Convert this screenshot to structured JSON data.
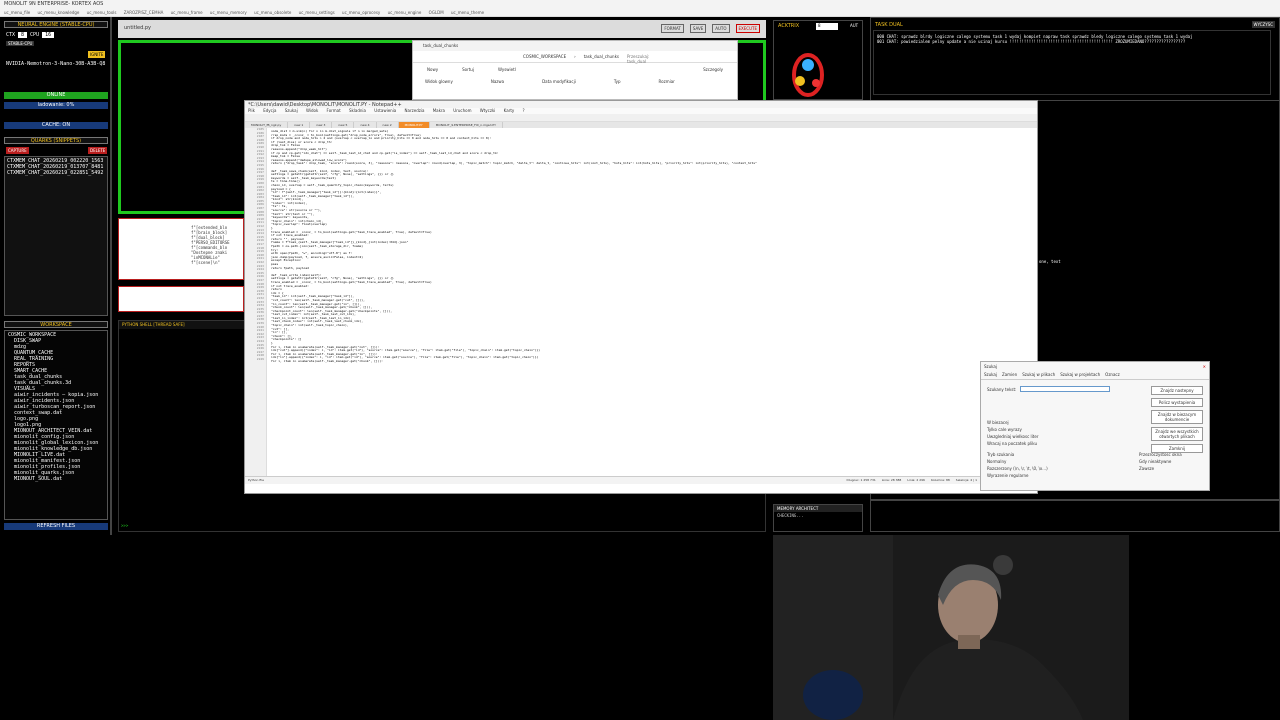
{
  "outer_window": {
    "title": "MONOLIT 9N ENTERPRISE- KORTEX AOS",
    "menu": [
      "uc_menu_file",
      "uc_menu_knowledge",
      "uc_menu_tools",
      "ZAROZPISZ_CEMHA",
      "uc_menu_frame",
      "uc_menu_memory",
      "uc_menu_obsolete",
      "uc_menu_settings",
      "uc_menu_oprocesy",
      "uc_menu_engine",
      "OGLDM",
      "uc_menu_theme"
    ]
  },
  "neural_engine": {
    "title": "NEURAL ENGINE (STABLE-CPU)",
    "ctx_label": "CTX",
    "ctx_value": "8",
    "cpu_label": "CPU",
    "cpu_value": "16",
    "badge": "STABLE-CPU",
    "ignite_button": "IGNITE",
    "model_name": "NVIDIA-Nemotron-3-Nano-30B-A3B-Q8",
    "online_label": "ONLINE",
    "loading_label": "ladowanie: 0%",
    "cache_label": "CACHE: ON"
  },
  "quarks": {
    "title": "QUARKS (SNIPPETS)",
    "capture_button": "CAPTURE",
    "delete_button": "DELETE",
    "items": [
      "CTXMEM_CHAT_20260219_002220_1563",
      "CTXMEM_CHAT_20260219_013707_8481",
      "CTXMEM_CHAT_20260219_022851_5492"
    ]
  },
  "workspace": {
    "title": "WORKSPACE",
    "root": "COSMIC_WORKSPACE",
    "items": [
      "DISK_SWAP",
      "mdzg",
      "QUANTUM_CACHE",
      "REAL_TRAINING",
      "REPORTS",
      "SMART_CACHE",
      "task_dual_chunks",
      "task_dual_chunks.3d",
      "VISUALS",
      "aiwir_incidents — kopia.json",
      "aiwir_incidents.json",
      "aiwir_turboscan_report.json",
      "context_swap.dat",
      "logo.png",
      "logo1.png",
      "MIONOUT_ARCHITECT_VEIN.dat",
      "mionolit_config.json",
      "mionolit_global_lexicon.json",
      "mionolit_knowledge_db.json",
      "MIONOLIT_LIVE.dat",
      "mionolit_manifest.json",
      "mionolit_profiles.json",
      "mionolit_quarks.json",
      "MIONOUT_SOUL.dat"
    ],
    "refresh_button": "REFRESH FILES"
  },
  "center_top": {
    "file_label": "untitled.py",
    "buttons": [
      "FORMAT",
      "SAVE",
      "AUTO",
      "EXECUTE"
    ]
  },
  "python_shell": {
    "title": "PYTHON SHELL [THREAD SAFE]",
    "prompt": ">>>"
  },
  "acktrix": {
    "title": "ACKTRIX",
    "value": "8",
    "mode": "AUT"
  },
  "task_dual": {
    "title": "TASK DUAL",
    "button": "WYCZYSC",
    "lines": [
      "000 CHAT: sprawdz blrdy logiczne calego systemu task 1 wydaj kompiet napraw task sprawdz bledy logiczne calego systemu task 1 wydaj",
      "001 CHAT: powiedzialem pelny update a nie ucinaj kursu !!!!!!!!!!!!!!!!!!!!!!!!!!!!!!!!!!!!!!!!!!! ZROZUMIEDANO?????????????????"
    ],
    "side_text": "one, text"
  },
  "memory_architect": {
    "title": "MEMORY ARCHITECT",
    "status": "CHECKING..."
  },
  "explorer": {
    "tab": "task_dual_chunks",
    "path": [
      "COSMIC_WORKSPACE",
      "task_dual_chunks"
    ],
    "search": "Przeszukaj: task_dual",
    "toolbar": [
      "Nowy",
      "Sortuj",
      "Wyswietl"
    ],
    "details": "Szczegoly",
    "columns": [
      "Nazwa",
      "Data modyfikacji",
      "Typ",
      "Rozmiar"
    ],
    "nav": "Widok glowny"
  },
  "notepad": {
    "title": "*C:\\Users\\dawid\\Desktop\\MONOLIT\\MONOLIT.PY - Notepad++",
    "menu": [
      "Plik",
      "Edycja",
      "Szukaj",
      "Widok",
      "Format",
      "Skladnia",
      "Ustawienia",
      "Narzedzia",
      "Makra",
      "Uruchom",
      "Wtyczki",
      "Karty",
      "?"
    ],
    "tabs": [
      "MONOLIT_fB_ngk.py",
      "new 1",
      "new 3",
      "new 5",
      "new 4",
      "new 2",
      "MONOLIT.PY",
      "MONOLIT_9.ENTERPRISE_FIX_n.mgsd.PY"
    ],
    "active_tab": "MONOLIT.PY",
    "line_start": 2185,
    "code": [
      "            node_dist = m.sim(n) for n in m.dist_signals if n in merged_sets)",
      "            rrsp_mods = _cconz_ = to_bool(settings.get(\"drop_node_errors\", True), default=True)",
      "            if drop_node and node_hits > 2 and (overlap < overlap_lo and priority_hits == 0 and node_hits == 0 and context_hits == 0):",
      "                if (last_diss) or score < drop_th:",
      "                    drop_tok = False",
      "                    reasons.append(\"drop_weak_hit\")",
      "            if cp and cp.get(\"idx_chat\") == self._task_last_id_chat and cp.get(\"is_index\") == self._task_last_id_chat and score < drop_tk:",
      "                keep_tok = False",
      "                reasons.append(\"dedupe_allowed_low_score\")",
      "            return {\"drop_task\": drop_task, \"score\": round(score, 3), \"reasons\": reasons, \"overlap\": round(overlap, 3), \"topic_match\": topic_match, \"delta_t\": delta_t, \"continue_hits\": int(cont_hits), \"hots_hits\": int(hots_hits), \"priority_hits\": int(priority_hits), \"context_hits\"",
      "",
      "        def _task_save_chunk(self, kind, index, text, source):",
      "            settings = getattr(getattr(self, \"cfg\", None), \"settings\", {}) or {}",
      "            keywords = self._task_keywords(text)",
      "            ts = time.time()",
      "            chain_id, overlap = self._task_quantify_topic_chain(keywords, ts=ts)",
      "            payload = {",
      "                \"id\": f\"{self._task_manager[\"task_id\"]}:{kind}:{int(index)}\",",
      "                \"task_id\": int(self._task_manager[\"task_id\"]),",
      "                \"kind\": str(kind),",
      "                \"index\": int(index),",
      "                \"ts\": ts,",
      "                \"source\": str(source or \"\"),",
      "                \"text\": str(text or \"\"),",
      "                \"keywords\": keywords,",
      "                \"topic_chain\": int(chain_id),",
      "                \"topic_overlap\": float(overlap)",
      "            }",
      "            trace_enabled = _cconz_ = to_bool(settings.get(\"task_trace_enabled\", True), default=True)",
      "            if not trace_enabled:",
      "                return \"\", payload",
      "            fname = f\"task_{self._task_manager[\"task_id\"]}_{kind}_{int(index):04d}.json\"",
      "            fpath = os.path.join(self._task_storage_dir, fname)",
      "            try:",
      "                with open(fpath, \"w\", encoding=\"utf-8\") as f:",
      "                    json.dump(payload, f, ensure_ascii=False, indent=2)",
      "            except Exception:",
      "                pass",
      "            return fpath, payload",
      "",
      "        def _task_write_index(self):",
      "            settings = getattr(getattr(self, \"cfg\", None), \"settings\", {}) or {}",
      "            trace_enabled = _cconz_ = to_bool(settings.get(\"task_trace_enabled\", True), default=True)",
      "            if not trace_enabled:",
      "                return",
      "            idx = {",
      "                \"task_id\": int(self._task_manager[\"task_id\"]),",
      "                \"cut_count\": len(self._task_manager.get(\"cut\", [])),",
      "                \"in_count\": len(self._task_manager.get(\"in\", [])),",
      "                \"chunk_count\": len(self._task_manager.get(\"chunk\", [])),",
      "                \"checkpoint_count\": len(self._task_manager.get(\"checkpoints\", [])),",
      "                \"last_cut_index\": int(self._task_last_cut_idx),",
      "                \"last_in_index\": int(self._task_last_in_idx),",
      "                \"last_chunk_index\": int(self._task_last_chunk_idx),",
      "                \"topic_chain\": int(self._task_topic_chain),",
      "                \"cut\": [],",
      "                \"in\": [],",
      "                \"chunk\": [],",
      "                \"checkpoints\": []",
      "            }",
      "            for i, item in enumerate(self._task_manager.get(\"cut\", [])):",
      "                idx[\"cut\"].append({\"index\": i, \"id\": item.get(\"id\"), \"source\": item.get(\"source\"), \"file\": item.get(\"file\"), \"topic_chain\": item.get(\"topic_chain\")})",
      "            for i, item in enumerate(self._task_manager.get(\"in\", [])):",
      "                idx[\"in\"].append({\"index\": i, \"id\": item.get(\"id\"), \"source\": item.get(\"source\"), \"file\": item.get(\"file\"), \"topic_chain\": item.get(\"topic_chain\")})",
      "            for i, item in enumerate(self._task_manager.get(\"chunk\", [])):"
    ],
    "status_left": "Python file",
    "status_right": [
      "Dlugosc: 1 258 731",
      "Linie: 28 388",
      "Linia: 2 296",
      "Kolumna: 88",
      "Selekcja: 4 | 1",
      "Windows (CR LF)",
      "UTF-8",
      "INS"
    ]
  },
  "find_dialog": {
    "title": "Szukaj",
    "tabs": [
      "Szukaj",
      "Zamien",
      "Szukaj w plikach",
      "Szukaj w projektach",
      "Oznacz"
    ],
    "field_label": "Szukany tekst:",
    "field_value": "",
    "buttons": [
      "Znajdz nastepny",
      "Policz wystapienia",
      "Znajdz w biezacym dokumencie",
      "Znajdz we wszystkich otwartych plikach",
      "Zamknij"
    ],
    "options": [
      "W biezacej",
      "Ca le slowa",
      "Tylko cale wyrazy",
      "Uwzgledniaj wielkosc liter",
      "Wracaj na poczatek pliku"
    ],
    "mode_title": "Tryb szukania",
    "modes": [
      "Normalny",
      "Rozszerzony (\\n, \\r, \\t, \\0, \\x...)",
      "Wyrazenie regularne"
    ],
    "transparency_title": "Przezroczystosc okna",
    "transparency_modes": [
      "Gdy nieaktywne",
      "Zawsze"
    ]
  },
  "colors": {
    "accent_yellow": "#f0c020",
    "workspace_blue": "#173a7a",
    "active_tab_orange": "#f28c28",
    "online_green": "#1fa31f",
    "danger_red": "#b91e1e"
  }
}
